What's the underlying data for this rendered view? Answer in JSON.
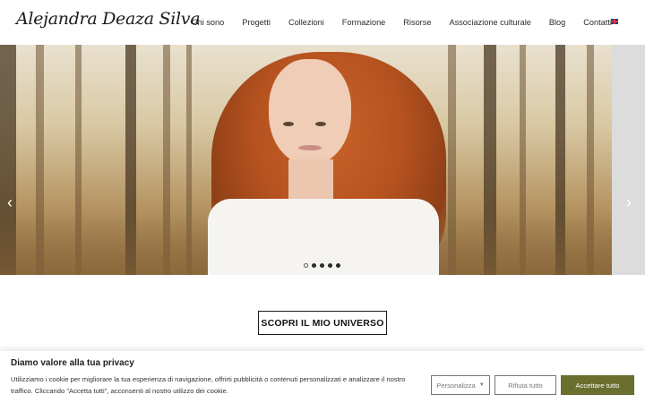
{
  "header": {
    "logo": "Alejandra Deaza Silva",
    "nav": [
      "Chi sono",
      "Progetti",
      "Collezioni",
      "Formazione",
      "Risorse",
      "Associazione culturale",
      "Blog",
      "Contatti"
    ],
    "language_flag": "uk-flag-icon"
  },
  "slider": {
    "slide_count": 5,
    "active_index": 0,
    "prev_icon": "chevron-left-icon",
    "next_icon": "chevron-right-icon"
  },
  "cta": {
    "label": "SCOPRI IL MIO UNIVERSO"
  },
  "cookie": {
    "title": "Diamo valore alla tua privacy",
    "text": "Utilizziamo i cookie per migliorare la tua esperienza di navigazione, offrirti pubblicità o contenuti personalizzati e analizzare il nostro traffico. Cliccando \"Accetta tutti\", acconsenti al nostro utilizzo dei cookie.",
    "personalize_label": "Personalizza",
    "reject_label": "Rifiuta tutto",
    "accept_label": "Accettare tutto",
    "accept_color": "#6a6f2f"
  }
}
